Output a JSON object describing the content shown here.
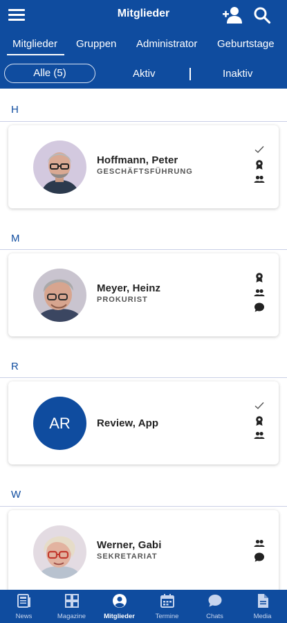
{
  "header": {
    "title": "Mitglieder"
  },
  "tabs": [
    {
      "label": "Mitglieder",
      "active": true
    },
    {
      "label": "Gruppen",
      "active": false
    },
    {
      "label": "Administrator",
      "active": false
    },
    {
      "label": "Geburtstage",
      "active": false
    }
  ],
  "filters": [
    {
      "label": "Alle (5)",
      "active": true
    },
    {
      "label": "Aktiv",
      "active": false
    },
    {
      "label": "Inaktiv",
      "active": false
    }
  ],
  "sections": [
    {
      "letter": "H",
      "members": [
        {
          "name": "Hoffmann, Peter",
          "role": "GESCHÄFTSFÜHRUNG",
          "icons": [
            "check-icon",
            "award-icon",
            "group-icon"
          ]
        }
      ]
    },
    {
      "letter": "M",
      "members": [
        {
          "name": "Meyer, Heinz",
          "role": "PROKURIST",
          "icons": [
            "award-icon",
            "group-icon",
            "chat-icon"
          ]
        }
      ]
    },
    {
      "letter": "R",
      "members": [
        {
          "name": "Review, App",
          "role": "",
          "initials": "AR",
          "icons": [
            "check-icon",
            "award-icon",
            "group-icon"
          ]
        }
      ]
    },
    {
      "letter": "W",
      "members": [
        {
          "name": "Werner, Gabi",
          "role": "SEKRETARIAT",
          "icons": [
            "group-icon",
            "chat-icon"
          ]
        }
      ]
    }
  ],
  "bottom_nav": [
    {
      "label": "News",
      "icon": "news-icon",
      "active": false
    },
    {
      "label": "Magazine",
      "icon": "magazine-icon",
      "active": false
    },
    {
      "label": "Mitglieder",
      "icon": "person-icon",
      "active": true
    },
    {
      "label": "Termine",
      "icon": "calendar-icon",
      "active": false
    },
    {
      "label": "Chats",
      "icon": "chat-icon",
      "active": false
    },
    {
      "label": "Media",
      "icon": "document-icon",
      "active": false
    }
  ],
  "colors": {
    "primary": "#0f4c9f",
    "accent_line": "#c9cfe6",
    "avatar_bg": "#0f4c9f"
  }
}
